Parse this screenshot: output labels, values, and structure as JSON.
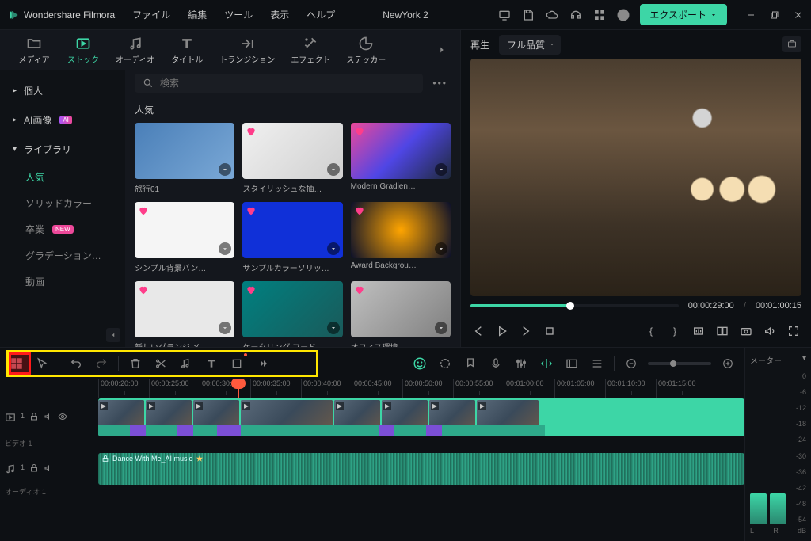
{
  "app": {
    "name": "Wondershare Filmora"
  },
  "menu": {
    "file": "ファイル",
    "edit": "編集",
    "tool": "ツール",
    "view": "表示",
    "help": "ヘルプ"
  },
  "project": {
    "name": "NewYork 2"
  },
  "export": {
    "label": "エクスポート"
  },
  "tabs": {
    "media": "メディア",
    "stock": "ストック",
    "audio": "オーディオ",
    "title": "タイトル",
    "transition": "トランジション",
    "effect": "エフェクト",
    "sticker": "ステッカー"
  },
  "sidebar": {
    "personal": "個人",
    "aiimage": "AI画像",
    "ai_badge": "AI",
    "library": "ライブラリ",
    "items": {
      "popular": "人気",
      "solid": "ソリッドカラー",
      "grad": "卒業",
      "gradation": "グラデーション…",
      "video": "動画"
    },
    "new_badge": "NEW"
  },
  "search": {
    "placeholder": "検索"
  },
  "section": {
    "popular": "人気"
  },
  "stock": {
    "i0": "旅行01",
    "i1": "スタイリッシュな抽…",
    "i2": "Modern Gradien…",
    "i3": "シンプル背景バン…",
    "i4": "サンプルカラーソリッ…",
    "i5": "Award Backgrou…",
    "i6": "新しいグランジ メ…",
    "i7": "ケータリング フード …",
    "i8": "オフィス環境"
  },
  "preview": {
    "play_label": "再生",
    "quality": "フル品質",
    "current": "00:00:29:00",
    "sep": "/",
    "duration": "00:01:00:15"
  },
  "ruler": {
    "t0": "00:00:20:00",
    "t1": "00:00:25:00",
    "t2": "00:00:30:00",
    "t3": "00:00:35:00",
    "t4": "00:00:40:00",
    "t5": "00:00:45:00",
    "t6": "00:00:50:00",
    "t7": "00:00:55:00",
    "t8": "00:01:00:00",
    "t9": "00:01:05:00",
    "t10": "00:01:10:00",
    "t11": "00:01:15:00"
  },
  "tracks": {
    "video1": "ビデオ 1",
    "audio1": "オーディオ 1",
    "clip_audio": "Dance With Me_AI music"
  },
  "meter": {
    "label": "メーター",
    "m0": "0",
    "m6": "-6",
    "m12": "-12",
    "m18": "-18",
    "m24": "-24",
    "m30": "-30",
    "m36": "-36",
    "m42": "-42",
    "m48": "-48",
    "m54": "-54",
    "L": "L",
    "R": "R",
    "dB": "dB"
  }
}
